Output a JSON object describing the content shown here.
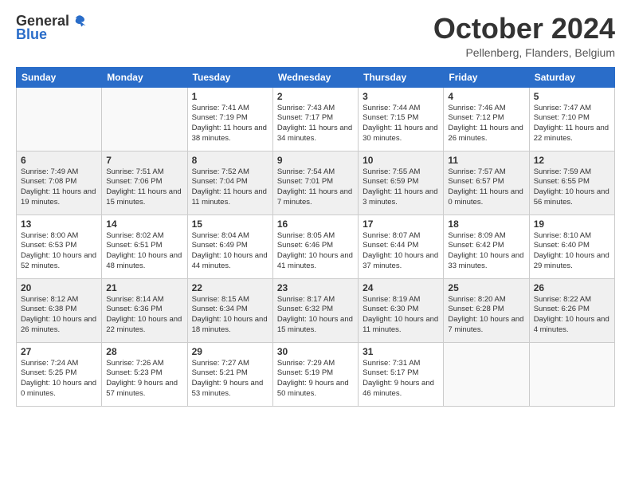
{
  "logo": {
    "general": "General",
    "blue": "Blue"
  },
  "header": {
    "month": "October 2024",
    "location": "Pellenberg, Flanders, Belgium"
  },
  "weekdays": [
    "Sunday",
    "Monday",
    "Tuesday",
    "Wednesday",
    "Thursday",
    "Friday",
    "Saturday"
  ],
  "weeks": [
    [
      {
        "day": "",
        "sunrise": "",
        "sunset": "",
        "daylight": ""
      },
      {
        "day": "",
        "sunrise": "",
        "sunset": "",
        "daylight": ""
      },
      {
        "day": "1",
        "sunrise": "Sunrise: 7:41 AM",
        "sunset": "Sunset: 7:19 PM",
        "daylight": "Daylight: 11 hours and 38 minutes."
      },
      {
        "day": "2",
        "sunrise": "Sunrise: 7:43 AM",
        "sunset": "Sunset: 7:17 PM",
        "daylight": "Daylight: 11 hours and 34 minutes."
      },
      {
        "day": "3",
        "sunrise": "Sunrise: 7:44 AM",
        "sunset": "Sunset: 7:15 PM",
        "daylight": "Daylight: 11 hours and 30 minutes."
      },
      {
        "day": "4",
        "sunrise": "Sunrise: 7:46 AM",
        "sunset": "Sunset: 7:12 PM",
        "daylight": "Daylight: 11 hours and 26 minutes."
      },
      {
        "day": "5",
        "sunrise": "Sunrise: 7:47 AM",
        "sunset": "Sunset: 7:10 PM",
        "daylight": "Daylight: 11 hours and 22 minutes."
      }
    ],
    [
      {
        "day": "6",
        "sunrise": "Sunrise: 7:49 AM",
        "sunset": "Sunset: 7:08 PM",
        "daylight": "Daylight: 11 hours and 19 minutes."
      },
      {
        "day": "7",
        "sunrise": "Sunrise: 7:51 AM",
        "sunset": "Sunset: 7:06 PM",
        "daylight": "Daylight: 11 hours and 15 minutes."
      },
      {
        "day": "8",
        "sunrise": "Sunrise: 7:52 AM",
        "sunset": "Sunset: 7:04 PM",
        "daylight": "Daylight: 11 hours and 11 minutes."
      },
      {
        "day": "9",
        "sunrise": "Sunrise: 7:54 AM",
        "sunset": "Sunset: 7:01 PM",
        "daylight": "Daylight: 11 hours and 7 minutes."
      },
      {
        "day": "10",
        "sunrise": "Sunrise: 7:55 AM",
        "sunset": "Sunset: 6:59 PM",
        "daylight": "Daylight: 11 hours and 3 minutes."
      },
      {
        "day": "11",
        "sunrise": "Sunrise: 7:57 AM",
        "sunset": "Sunset: 6:57 PM",
        "daylight": "Daylight: 11 hours and 0 minutes."
      },
      {
        "day": "12",
        "sunrise": "Sunrise: 7:59 AM",
        "sunset": "Sunset: 6:55 PM",
        "daylight": "Daylight: 10 hours and 56 minutes."
      }
    ],
    [
      {
        "day": "13",
        "sunrise": "Sunrise: 8:00 AM",
        "sunset": "Sunset: 6:53 PM",
        "daylight": "Daylight: 10 hours and 52 minutes."
      },
      {
        "day": "14",
        "sunrise": "Sunrise: 8:02 AM",
        "sunset": "Sunset: 6:51 PM",
        "daylight": "Daylight: 10 hours and 48 minutes."
      },
      {
        "day": "15",
        "sunrise": "Sunrise: 8:04 AM",
        "sunset": "Sunset: 6:49 PM",
        "daylight": "Daylight: 10 hours and 44 minutes."
      },
      {
        "day": "16",
        "sunrise": "Sunrise: 8:05 AM",
        "sunset": "Sunset: 6:46 PM",
        "daylight": "Daylight: 10 hours and 41 minutes."
      },
      {
        "day": "17",
        "sunrise": "Sunrise: 8:07 AM",
        "sunset": "Sunset: 6:44 PM",
        "daylight": "Daylight: 10 hours and 37 minutes."
      },
      {
        "day": "18",
        "sunrise": "Sunrise: 8:09 AM",
        "sunset": "Sunset: 6:42 PM",
        "daylight": "Daylight: 10 hours and 33 minutes."
      },
      {
        "day": "19",
        "sunrise": "Sunrise: 8:10 AM",
        "sunset": "Sunset: 6:40 PM",
        "daylight": "Daylight: 10 hours and 29 minutes."
      }
    ],
    [
      {
        "day": "20",
        "sunrise": "Sunrise: 8:12 AM",
        "sunset": "Sunset: 6:38 PM",
        "daylight": "Daylight: 10 hours and 26 minutes."
      },
      {
        "day": "21",
        "sunrise": "Sunrise: 8:14 AM",
        "sunset": "Sunset: 6:36 PM",
        "daylight": "Daylight: 10 hours and 22 minutes."
      },
      {
        "day": "22",
        "sunrise": "Sunrise: 8:15 AM",
        "sunset": "Sunset: 6:34 PM",
        "daylight": "Daylight: 10 hours and 18 minutes."
      },
      {
        "day": "23",
        "sunrise": "Sunrise: 8:17 AM",
        "sunset": "Sunset: 6:32 PM",
        "daylight": "Daylight: 10 hours and 15 minutes."
      },
      {
        "day": "24",
        "sunrise": "Sunrise: 8:19 AM",
        "sunset": "Sunset: 6:30 PM",
        "daylight": "Daylight: 10 hours and 11 minutes."
      },
      {
        "day": "25",
        "sunrise": "Sunrise: 8:20 AM",
        "sunset": "Sunset: 6:28 PM",
        "daylight": "Daylight: 10 hours and 7 minutes."
      },
      {
        "day": "26",
        "sunrise": "Sunrise: 8:22 AM",
        "sunset": "Sunset: 6:26 PM",
        "daylight": "Daylight: 10 hours and 4 minutes."
      }
    ],
    [
      {
        "day": "27",
        "sunrise": "Sunrise: 7:24 AM",
        "sunset": "Sunset: 5:25 PM",
        "daylight": "Daylight: 10 hours and 0 minutes."
      },
      {
        "day": "28",
        "sunrise": "Sunrise: 7:26 AM",
        "sunset": "Sunset: 5:23 PM",
        "daylight": "Daylight: 9 hours and 57 minutes."
      },
      {
        "day": "29",
        "sunrise": "Sunrise: 7:27 AM",
        "sunset": "Sunset: 5:21 PM",
        "daylight": "Daylight: 9 hours and 53 minutes."
      },
      {
        "day": "30",
        "sunrise": "Sunrise: 7:29 AM",
        "sunset": "Sunset: 5:19 PM",
        "daylight": "Daylight: 9 hours and 50 minutes."
      },
      {
        "day": "31",
        "sunrise": "Sunrise: 7:31 AM",
        "sunset": "Sunset: 5:17 PM",
        "daylight": "Daylight: 9 hours and 46 minutes."
      },
      {
        "day": "",
        "sunrise": "",
        "sunset": "",
        "daylight": ""
      },
      {
        "day": "",
        "sunrise": "",
        "sunset": "",
        "daylight": ""
      }
    ]
  ]
}
